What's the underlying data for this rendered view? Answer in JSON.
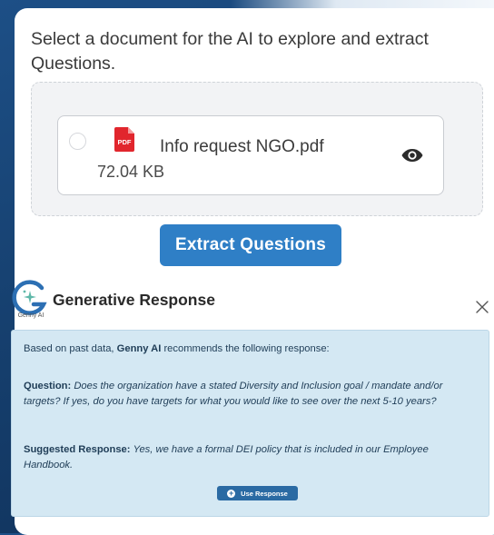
{
  "instructions": {
    "text": "Select a document for the AI to explore and extract Questions."
  },
  "document": {
    "name": "Info request NGO.pdf",
    "size": "72.04 KB",
    "icon_label": "PDF",
    "icon": "pdf-file-icon",
    "preview_icon": "eye-icon",
    "selected": false
  },
  "extract_button": {
    "label": "Extract Questions"
  },
  "generative": {
    "logo_caption": "Genny AI",
    "title": "Generative Response",
    "intro_prefix": "Based on past data, ",
    "intro_brand": "Genny AI",
    "intro_suffix": " recommends the following response:",
    "question_label": "Question:",
    "question_text": "Does the organization have a stated Diversity and Inclusion goal / mandate and/or targets? If yes, do you have targets for what you would like to see over the next 5-10 years?",
    "suggested_label": "Suggested Response:",
    "suggested_text": "Yes, we have a formal DEI policy that is included in our Employee Handbook.",
    "use_button_label": "Use Response"
  },
  "colors": {
    "accent": "#2f7fc6",
    "panel_bg": "#d4e8f3",
    "pdf_red": "#e1262d",
    "background": "#16406f"
  }
}
